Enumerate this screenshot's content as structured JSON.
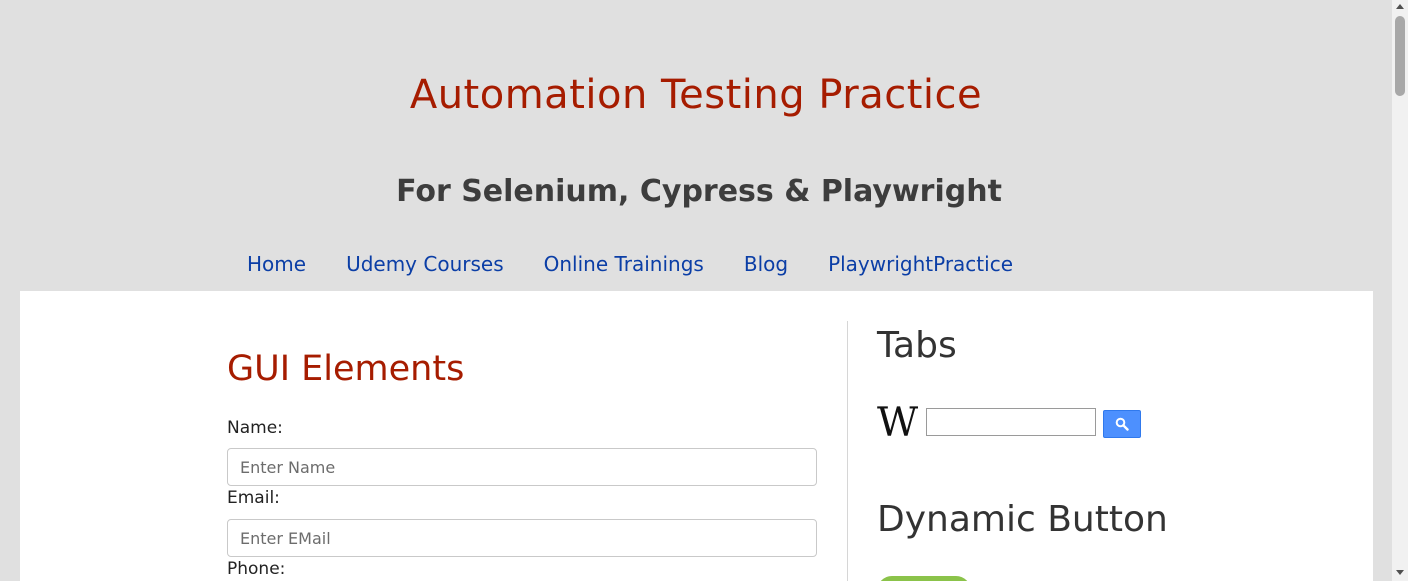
{
  "header": {
    "title": "Automation Testing Practice",
    "subtitle": "For Selenium, Cypress & Playwright"
  },
  "nav": {
    "items": [
      "Home",
      "Udemy Courses",
      "Online Trainings",
      "Blog",
      "PlaywrightPractice"
    ]
  },
  "main": {
    "section_title": "GUI Elements",
    "fields": [
      {
        "label": "Name:",
        "placeholder": "Enter Name",
        "value": ""
      },
      {
        "label": "Email:",
        "placeholder": "Enter EMail",
        "value": ""
      },
      {
        "label": "Phone:"
      }
    ]
  },
  "sidebar": {
    "tabs_title": "Tabs",
    "wiki_logo": "W",
    "wiki_search_value": "",
    "dynamic_title": "Dynamic Button"
  },
  "colors": {
    "title": "#a61c00",
    "nav_link": "#0b3ea6",
    "page_bg": "#e0e0e0",
    "search_button": "#4d90fe",
    "dynamic_button": "#8bc34a"
  }
}
